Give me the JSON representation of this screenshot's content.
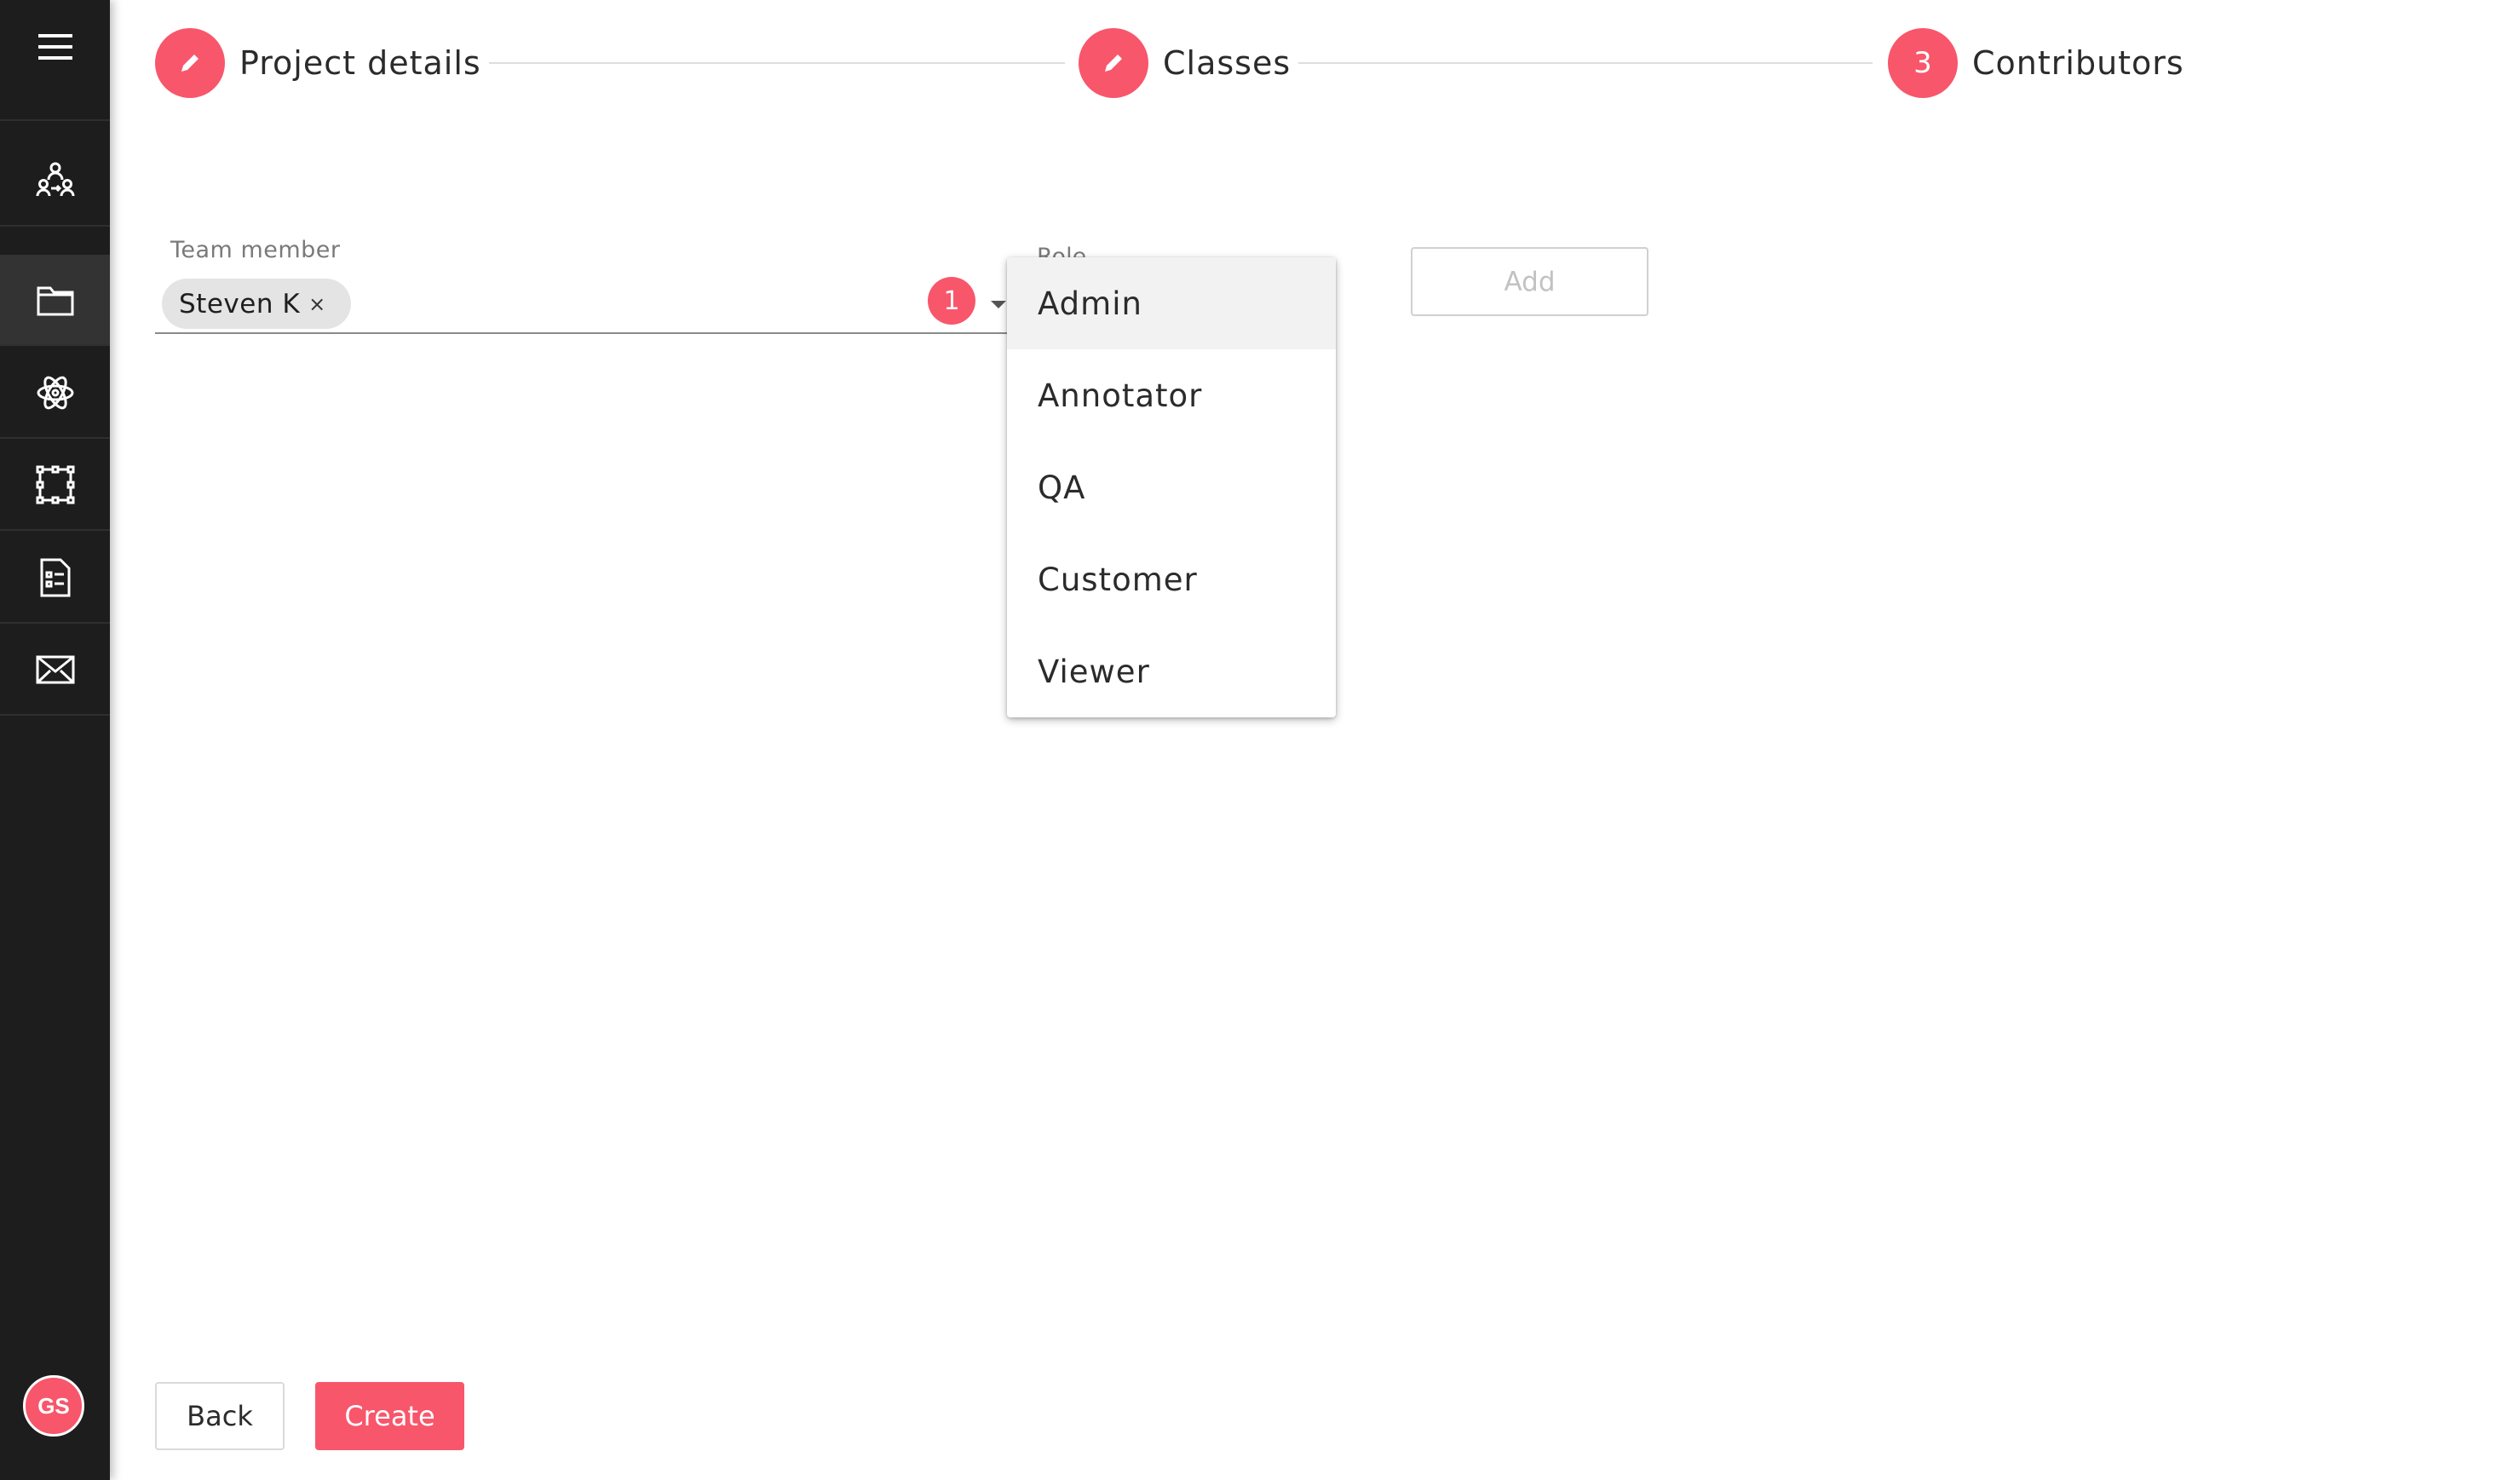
{
  "colors": {
    "accent": "#f8566b",
    "sidebar_bg": "#1d1d1d",
    "sidebar_active": "#333333"
  },
  "sidebar": {
    "menu_icon": "hamburger-menu-icon",
    "items": [
      {
        "icon": "team-icon",
        "active": false
      },
      {
        "icon": "folder-icon",
        "active": true
      },
      {
        "icon": "atom-icon",
        "active": false
      },
      {
        "icon": "bounding-box-icon",
        "active": false
      },
      {
        "icon": "document-list-icon",
        "active": false
      },
      {
        "icon": "mail-icon",
        "active": false
      }
    ],
    "avatar_initials": "GS"
  },
  "stepper": {
    "steps": [
      {
        "label": "Project details",
        "icon": "pencil-icon"
      },
      {
        "label": "Classes",
        "icon": "pencil-icon"
      },
      {
        "label": "Contributors",
        "number": "3"
      }
    ]
  },
  "form": {
    "team_member_label": "Team member",
    "selected_chip": "Steven K",
    "chip_remove": "×",
    "selected_count": "1",
    "role_label": "Role",
    "role_options": [
      "Admin",
      "Annotator",
      "QA",
      "Customer",
      "Viewer"
    ],
    "highlighted_option": "Admin",
    "add_label": "Add"
  },
  "footer": {
    "back_label": "Back",
    "create_label": "Create"
  }
}
